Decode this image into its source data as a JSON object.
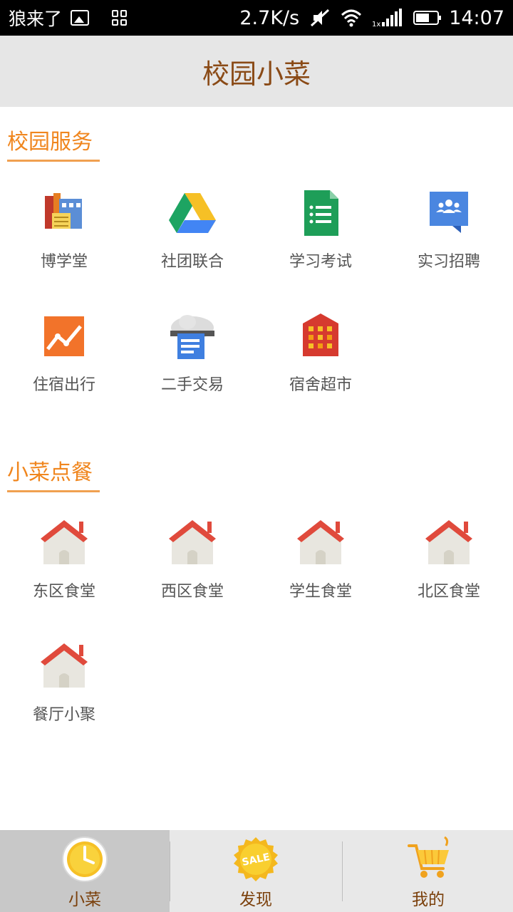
{
  "status_bar": {
    "app_name": "狼来了",
    "net_speed": "2.7K/s",
    "time": "14:07"
  },
  "header": {
    "title": "校园小菜"
  },
  "sections": [
    {
      "title": "校园服务",
      "items": [
        {
          "label": "博学堂",
          "icon": "building-icon"
        },
        {
          "label": "社团联合",
          "icon": "drive-triangle-icon"
        },
        {
          "label": "学习考试",
          "icon": "sheet-icon"
        },
        {
          "label": "实习招聘",
          "icon": "people-card-icon"
        },
        {
          "label": "住宿出行",
          "icon": "chart-icon"
        },
        {
          "label": "二手交易",
          "icon": "cloud-doc-icon"
        },
        {
          "label": "宿舍超市",
          "icon": "store-icon"
        }
      ]
    },
    {
      "title": "小菜点餐",
      "items": [
        {
          "label": "东区食堂",
          "icon": "house-icon"
        },
        {
          "label": "西区食堂",
          "icon": "house-icon"
        },
        {
          "label": "学生食堂",
          "icon": "house-icon"
        },
        {
          "label": "北区食堂",
          "icon": "house-icon"
        },
        {
          "label": "餐厅小聚",
          "icon": "house-icon"
        }
      ]
    }
  ],
  "bottom_nav": {
    "tabs": [
      {
        "label": "小菜",
        "icon": "clock-icon",
        "active": true
      },
      {
        "label": "发现",
        "icon": "sale-badge-icon",
        "active": false
      },
      {
        "label": "我的",
        "icon": "cart-icon",
        "active": false
      }
    ],
    "sale_text": "SALE"
  },
  "colors": {
    "accent": "#f0861e",
    "title_text": "#8a4a16",
    "header_bg": "#e6e6e6"
  }
}
